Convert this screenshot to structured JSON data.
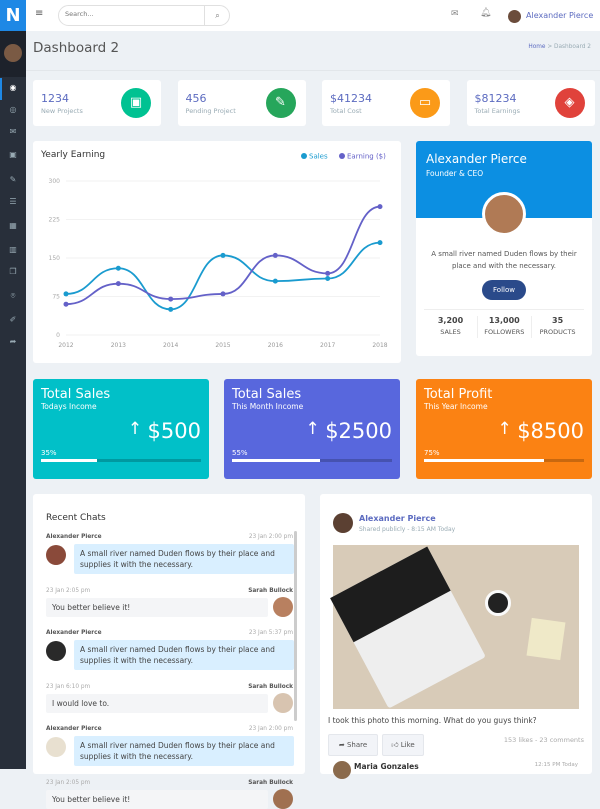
{
  "app": {
    "logo": "N"
  },
  "topbar": {
    "search_placeholder": "Search...",
    "user_name": "Alexander Pierce"
  },
  "sidebar": {
    "icons": [
      "dashboard-icon",
      "target-icon",
      "mail-icon",
      "briefcase-icon",
      "edit-icon",
      "table-icon",
      "grid-icon",
      "chart-icon",
      "copy-icon",
      "map-pin-icon",
      "brush-icon",
      "share-icon"
    ]
  },
  "page": {
    "title": "Dashboard 2",
    "breadcrumb": {
      "home": "Home",
      "sep": ">",
      "current": "Dashboard 2"
    }
  },
  "stats": [
    {
      "value": "1234",
      "label": "New Projects",
      "icon": "briefcase-icon",
      "color": "#00c292"
    },
    {
      "value": "456",
      "label": "Pending Project",
      "icon": "pencil-icon",
      "color": "#26a65b"
    },
    {
      "value": "$41234",
      "label": "Total Cost",
      "icon": "wallet-icon",
      "color": "#fb9a18"
    },
    {
      "value": "$81234",
      "label": "Total Earnings",
      "icon": "layers-icon",
      "color": "#e0423b"
    }
  ],
  "chart_data": {
    "type": "line",
    "title": "Yearly Earning",
    "x": [
      "2012",
      "2013",
      "2014",
      "2015",
      "2016",
      "2017",
      "2018"
    ],
    "yticks": [
      "0",
      "75",
      "150",
      "225",
      "300"
    ],
    "ylim": [
      0,
      300
    ],
    "legend_placement": "top-right",
    "series": [
      {
        "name": "Sales",
        "color": "#1a9bcf",
        "values": [
          80,
          130,
          50,
          155,
          105,
          110,
          180
        ]
      },
      {
        "name": "Earning ($)",
        "color": "#6461c8",
        "values": [
          60,
          100,
          70,
          80,
          155,
          120,
          250
        ]
      }
    ]
  },
  "profile": {
    "name": "Alexander Pierce",
    "role": "Founder & CEO",
    "bio": "A small river named Duden flows by their place and with the necessary.",
    "follow": "Follow",
    "stats": [
      {
        "value": "3,200",
        "label": "SALES"
      },
      {
        "value": "13,000",
        "label": "FOLLOWERS"
      },
      {
        "value": "35",
        "label": "PRODUCTS"
      }
    ]
  },
  "summary": [
    {
      "title": "Total Sales",
      "sub": "Todays Income",
      "value": "$500",
      "pct": "35%",
      "progress": 35,
      "color": "#01c0c8"
    },
    {
      "title": "Total Sales",
      "sub": "This Month Income",
      "value": "$2500",
      "pct": "55%",
      "progress": 55,
      "color": "#5867dd"
    },
    {
      "title": "Total Profit",
      "sub": "This Year Income",
      "value": "$8500",
      "pct": "75%",
      "progress": 75,
      "color": "#fb8213"
    }
  ],
  "chats": {
    "title": "Recent Chats",
    "messages": [
      {
        "side": "left",
        "name": "Alexander Pierce",
        "time": "23 Jan 2:00 pm",
        "text": "A small river named Duden flows by their place and supplies it with the necessary."
      },
      {
        "side": "right",
        "name": "Sarah Bullock",
        "time": "23 Jan 2:05 pm",
        "text": "You better believe it!"
      },
      {
        "side": "left",
        "name": "Alexander Pierce",
        "time": "23 Jan 5:37 pm",
        "text": "A small river named Duden flows by their place and supplies it with the necessary."
      },
      {
        "side": "right",
        "name": "Sarah Bullock",
        "time": "23 Jan 6:10 pm",
        "text": "I would love to."
      },
      {
        "side": "left",
        "name": "Alexander Pierce",
        "time": "23 Jan 2:00 pm",
        "text": "A small river named Duden flows by their place and supplies it with the necessary."
      },
      {
        "side": "right",
        "name": "Sarah Bullock",
        "time": "23 Jan 2:05 pm",
        "text": "You better believe it!"
      }
    ]
  },
  "post": {
    "author": "Alexander Pierce",
    "meta": "Shared publicly - 8:15 AM Today",
    "caption": "I took this photo this morning. What do you guys think?",
    "share": "Share",
    "like": "Like",
    "counts": "153 likes - 23 comments",
    "comment": {
      "name": "Maria Gonzales",
      "time": "12:15 PM Today"
    }
  }
}
